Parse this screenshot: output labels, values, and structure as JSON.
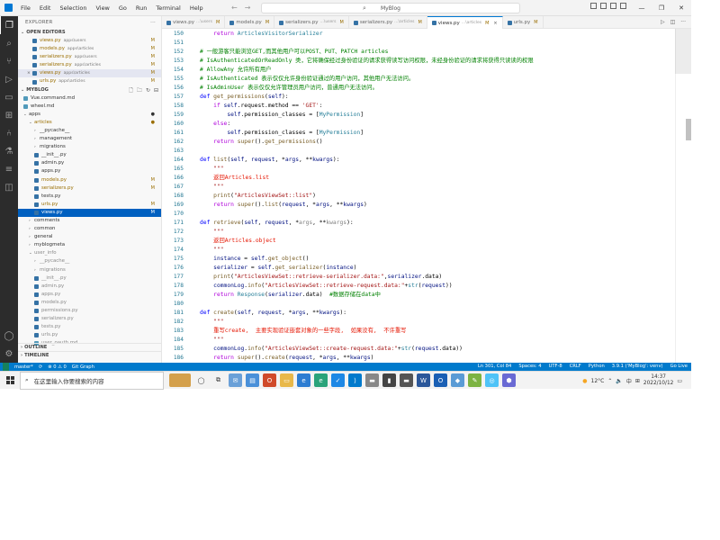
{
  "menu": [
    "File",
    "Edit",
    "Selection",
    "View",
    "Go",
    "Run",
    "Terminal",
    "Help"
  ],
  "search": "MyBlog",
  "sidebar": {
    "title": "EXPLORER",
    "open_editors_title": "OPEN EDITORS",
    "open_editors": [
      {
        "name": "views.py",
        "path": "apps\\users",
        "badge": "M"
      },
      {
        "name": "models.py",
        "path": "apps\\articles",
        "badge": "M"
      },
      {
        "name": "serializers.py",
        "path": "apps\\users",
        "badge": "M"
      },
      {
        "name": "serializers.py",
        "path": "apps\\articles",
        "badge": "M"
      },
      {
        "name": "views.py",
        "path": "apps\\articles",
        "badge": "M"
      },
      {
        "name": "urls.py",
        "path": "apps\\articles",
        "badge": "M"
      }
    ],
    "project_title": "MYBLOG",
    "tree": [
      {
        "label": "Vue.command.md",
        "depth": 1,
        "kind": "md"
      },
      {
        "label": "wheel.md",
        "depth": 1,
        "kind": "md"
      },
      {
        "label": "apps",
        "depth": 1,
        "kind": "folder-open",
        "badge": "●"
      },
      {
        "label": "articles",
        "depth": 2,
        "kind": "folder-open",
        "badge": "●",
        "cls": "mod"
      },
      {
        "label": "__pycache__",
        "depth": 3,
        "kind": "folder"
      },
      {
        "label": "management",
        "depth": 3,
        "kind": "folder"
      },
      {
        "label": "migrations",
        "depth": 3,
        "kind": "folder"
      },
      {
        "label": "__init__.py",
        "depth": 3,
        "kind": "py"
      },
      {
        "label": "admin.py",
        "depth": 3,
        "kind": "py"
      },
      {
        "label": "apps.py",
        "depth": 3,
        "kind": "py"
      },
      {
        "label": "models.py",
        "depth": 3,
        "kind": "py",
        "badge": "M",
        "cls": "mod"
      },
      {
        "label": "serializers.py",
        "depth": 3,
        "kind": "py",
        "badge": "M",
        "cls": "mod"
      },
      {
        "label": "tests.py",
        "depth": 3,
        "kind": "py"
      },
      {
        "label": "urls.py",
        "depth": 3,
        "kind": "py",
        "badge": "M",
        "cls": "mod"
      },
      {
        "label": "views.py",
        "depth": 3,
        "kind": "py",
        "badge": "M",
        "cls": "selected"
      },
      {
        "label": "comments",
        "depth": 2,
        "kind": "folder"
      },
      {
        "label": "common",
        "depth": 2,
        "kind": "folder"
      },
      {
        "label": "general",
        "depth": 2,
        "kind": "folder"
      },
      {
        "label": "myblogmeta",
        "depth": 2,
        "kind": "folder"
      },
      {
        "label": "user_info",
        "depth": 2,
        "kind": "folder-open",
        "cls": "grey"
      },
      {
        "label": "__pycache__",
        "depth": 3,
        "kind": "folder",
        "cls": "grey"
      },
      {
        "label": "migrations",
        "depth": 3,
        "kind": "folder",
        "cls": "grey"
      },
      {
        "label": "__init__.py",
        "depth": 3,
        "kind": "py",
        "cls": "grey"
      },
      {
        "label": "admin.py",
        "depth": 3,
        "kind": "py",
        "cls": "grey"
      },
      {
        "label": "apps.py",
        "depth": 3,
        "kind": "py",
        "cls": "grey"
      },
      {
        "label": "models.py",
        "depth": 3,
        "kind": "py",
        "cls": "grey"
      },
      {
        "label": "permissions.py",
        "depth": 3,
        "kind": "py",
        "cls": "grey"
      },
      {
        "label": "serializers.py",
        "depth": 3,
        "kind": "py",
        "cls": "grey"
      },
      {
        "label": "tests.py",
        "depth": 3,
        "kind": "py",
        "cls": "grey"
      },
      {
        "label": "urls.py",
        "depth": 3,
        "kind": "py",
        "cls": "grey"
      },
      {
        "label": "user_oauth.md",
        "depth": 3,
        "kind": "md",
        "cls": "grey"
      }
    ],
    "outline_title": "OUTLINE",
    "timeline_title": "TIMELINE"
  },
  "tabs": [
    {
      "name": "views.py",
      "path": "...\\users",
      "badge": "M"
    },
    {
      "name": "models.py",
      "path": "",
      "badge": "M"
    },
    {
      "name": "serializers.py",
      "path": "...\\users",
      "badge": "M"
    },
    {
      "name": "serializers.py",
      "path": "...\\articles",
      "badge": "M"
    },
    {
      "name": "views.py",
      "path": "...\\articles",
      "badge": "M",
      "active": true
    },
    {
      "name": "urls.py",
      "path": "",
      "badge": "M"
    }
  ],
  "code": [
    {
      "n": "150",
      "segs": [
        [
          "    ",
          ""
        ],
        [
          "return ",
          "kw2"
        ],
        [
          "ArticlesVisitorSerializer",
          "cls"
        ]
      ]
    },
    {
      "n": "151",
      "segs": []
    },
    {
      "n": "152",
      "segs": [
        [
          "# 一般游客只能浏览GET,而其他用户可以POST、PUT、PATCH articles",
          "cmt"
        ]
      ]
    },
    {
      "n": "153",
      "segs": [
        [
          "# IsAuthenticatedOrReadOnly 类，它将确保经过身份验证的请求获得读写访问权限，未经身份验证的请求将获得只读读的权限",
          "cmt"
        ]
      ]
    },
    {
      "n": "154",
      "segs": [
        [
          "# AllowAny 允许所有用户",
          "cmt"
        ]
      ]
    },
    {
      "n": "155",
      "segs": [
        [
          "# IsAuthenticated 表示仅仅允许身份验证通过的用户访问，其他用户无法访问。",
          "cmt"
        ]
      ]
    },
    {
      "n": "156",
      "segs": [
        [
          "# IsAdminUser 表示仅仅允许管理员用户访问，普通用户无法访问。",
          "cmt"
        ]
      ]
    },
    {
      "n": "157",
      "segs": [
        [
          "def ",
          "kw"
        ],
        [
          "get_permissions",
          "fnc"
        ],
        [
          "(",
          ""
        ],
        [
          "self",
          "var"
        ],
        [
          "):",
          ""
        ]
      ]
    },
    {
      "n": "158",
      "segs": [
        [
          "    ",
          ""
        ],
        [
          "if ",
          "kw2"
        ],
        [
          "self",
          "var"
        ],
        [
          ".request.method == ",
          ""
        ],
        [
          "'GET'",
          "str"
        ],
        [
          ":",
          ""
        ]
      ]
    },
    {
      "n": "159",
      "segs": [
        [
          "        ",
          ""
        ],
        [
          "self",
          "var"
        ],
        [
          ".permission_classes = [",
          ""
        ],
        [
          "MyPermission",
          "cls"
        ],
        [
          "]",
          ""
        ]
      ]
    },
    {
      "n": "160",
      "segs": [
        [
          "    ",
          ""
        ],
        [
          "else",
          "kw2"
        ],
        [
          ":",
          ""
        ]
      ]
    },
    {
      "n": "161",
      "segs": [
        [
          "        ",
          ""
        ],
        [
          "self",
          "var"
        ],
        [
          ".permission_classes = [",
          ""
        ],
        [
          "MyPermission",
          "cls"
        ],
        [
          "]",
          ""
        ]
      ]
    },
    {
      "n": "162",
      "segs": [
        [
          "    ",
          ""
        ],
        [
          "return ",
          "kw2"
        ],
        [
          "super",
          "fnc"
        ],
        [
          "().",
          ""
        ],
        [
          "get_permissions",
          "fnc"
        ],
        [
          "()",
          ""
        ]
      ]
    },
    {
      "n": "163",
      "segs": []
    },
    {
      "n": "164",
      "segs": [
        [
          "def ",
          "kw"
        ],
        [
          "list",
          "fnc"
        ],
        [
          "(",
          ""
        ],
        [
          "self",
          "var"
        ],
        [
          ", ",
          ""
        ],
        [
          "request",
          "var"
        ],
        [
          ", *",
          ""
        ],
        [
          "args",
          "var"
        ],
        [
          ", **",
          ""
        ],
        [
          "kwargs",
          "var"
        ],
        [
          "):",
          ""
        ]
      ]
    },
    {
      "n": "165",
      "segs": [
        [
          "    \"\"\"",
          "str"
        ]
      ]
    },
    {
      "n": "166",
      "segs": [
        [
          "    返回Articles.list",
          "hl"
        ]
      ]
    },
    {
      "n": "167",
      "segs": [
        [
          "    \"\"\"",
          "str"
        ]
      ]
    },
    {
      "n": "168",
      "segs": [
        [
          "    ",
          ""
        ],
        [
          "print",
          "fnc"
        ],
        [
          "(",
          ""
        ],
        [
          "\"ArticlesViewSet::list\"",
          "str"
        ],
        [
          ")",
          ""
        ]
      ]
    },
    {
      "n": "169",
      "segs": [
        [
          "    ",
          ""
        ],
        [
          "return ",
          "kw2"
        ],
        [
          "super",
          "fnc"
        ],
        [
          "().",
          ""
        ],
        [
          "list",
          "fnc"
        ],
        [
          "(",
          ""
        ],
        [
          "request",
          "var"
        ],
        [
          ", *",
          ""
        ],
        [
          "args",
          "var"
        ],
        [
          ", **",
          ""
        ],
        [
          "kwargs",
          "var"
        ],
        [
          ")",
          ""
        ]
      ]
    },
    {
      "n": "170",
      "segs": []
    },
    {
      "n": "171",
      "segs": [
        [
          "def ",
          "kw"
        ],
        [
          "retrieve",
          "fnc"
        ],
        [
          "(",
          ""
        ],
        [
          "self",
          "var"
        ],
        [
          ", ",
          ""
        ],
        [
          "request",
          "var"
        ],
        [
          ", *",
          ""
        ],
        [
          "args",
          "par"
        ],
        [
          ", **",
          ""
        ],
        [
          "kwargs",
          "par"
        ],
        [
          "):",
          ""
        ]
      ]
    },
    {
      "n": "172",
      "segs": [
        [
          "    \"\"\"",
          "str"
        ]
      ]
    },
    {
      "n": "173",
      "segs": [
        [
          "    返回Articles.object",
          "hl"
        ]
      ]
    },
    {
      "n": "174",
      "segs": [
        [
          "    \"\"\"",
          "str"
        ]
      ]
    },
    {
      "n": "175",
      "segs": [
        [
          "    ",
          ""
        ],
        [
          "instance",
          "var"
        ],
        [
          " = ",
          ""
        ],
        [
          "self",
          "var"
        ],
        [
          ".",
          ""
        ],
        [
          "get_object",
          "fnc"
        ],
        [
          "()",
          ""
        ]
      ]
    },
    {
      "n": "176",
      "segs": [
        [
          "    ",
          ""
        ],
        [
          "serializer",
          "var"
        ],
        [
          " = ",
          ""
        ],
        [
          "self",
          "var"
        ],
        [
          ".",
          ""
        ],
        [
          "get_serializer",
          "fnc"
        ],
        [
          "(",
          ""
        ],
        [
          "instance",
          "var"
        ],
        [
          ")",
          ""
        ]
      ]
    },
    {
      "n": "177",
      "segs": [
        [
          "    ",
          ""
        ],
        [
          "print",
          "fnc"
        ],
        [
          "(",
          ""
        ],
        [
          "\"ArticlesViewSet::retrieve-serializer.data:\"",
          "str"
        ],
        [
          ",",
          ""
        ],
        [
          "serializer",
          "var"
        ],
        [
          ".data)",
          ""
        ]
      ]
    },
    {
      "n": "178",
      "segs": [
        [
          "    ",
          ""
        ],
        [
          "commonLog",
          "var"
        ],
        [
          ".",
          ""
        ],
        [
          "info",
          "fnc"
        ],
        [
          "(",
          ""
        ],
        [
          "\"ArticlesViewSet::retrieve-request.data:\"",
          "str"
        ],
        [
          "+",
          ""
        ],
        [
          "str",
          "cls"
        ],
        [
          "(",
          ""
        ],
        [
          "request",
          "var"
        ],
        [
          "))",
          ""
        ]
      ]
    },
    {
      "n": "179",
      "segs": [
        [
          "    ",
          ""
        ],
        [
          "return ",
          "kw2"
        ],
        [
          "Response",
          "cls"
        ],
        [
          "(",
          ""
        ],
        [
          "serializer",
          "var"
        ],
        [
          ".data)  ",
          ""
        ],
        [
          "#数据存储在data中",
          "cmt"
        ]
      ]
    },
    {
      "n": "180",
      "segs": []
    },
    {
      "n": "181",
      "segs": [
        [
          "def ",
          "kw"
        ],
        [
          "create",
          "fnc"
        ],
        [
          "(",
          ""
        ],
        [
          "self",
          "var"
        ],
        [
          ", ",
          ""
        ],
        [
          "request",
          "var"
        ],
        [
          ", *",
          ""
        ],
        [
          "args",
          "var"
        ],
        [
          ", **",
          ""
        ],
        [
          "kwargs",
          "var"
        ],
        [
          "):",
          ""
        ]
      ]
    },
    {
      "n": "182",
      "segs": [
        [
          "    \"\"\"",
          "str"
        ]
      ]
    },
    {
      "n": "183",
      "segs": [
        [
          "    重写create,  主要实现验证嵌套对象的一些字段,  如果没有,  不许重写",
          "hl"
        ]
      ]
    },
    {
      "n": "184",
      "segs": [
        [
          "    \"\"\"",
          "str"
        ]
      ]
    },
    {
      "n": "185",
      "segs": [
        [
          "    ",
          ""
        ],
        [
          "commonLog",
          "var"
        ],
        [
          ".",
          ""
        ],
        [
          "info",
          "fnc"
        ],
        [
          "(",
          ""
        ],
        [
          "\"ArticlesViewSet::create-request.data:\"",
          "str"
        ],
        [
          "+",
          ""
        ],
        [
          "str",
          "cls"
        ],
        [
          "(",
          ""
        ],
        [
          "request",
          "var"
        ],
        [
          ".data))",
          ""
        ]
      ]
    },
    {
      "n": "186",
      "segs": [
        [
          "    ",
          ""
        ],
        [
          "return ",
          "kw2"
        ],
        [
          "super",
          "fnc"
        ],
        [
          "().",
          ""
        ],
        [
          "create",
          "fnc"
        ],
        [
          "(",
          ""
        ],
        [
          "request",
          "var"
        ],
        [
          ", *",
          ""
        ],
        [
          "args",
          "var"
        ],
        [
          ", **",
          ""
        ],
        [
          "kwargs",
          "var"
        ],
        [
          ")",
          ""
        ]
      ]
    }
  ],
  "status": {
    "branch": "master*",
    "sync": "⟳",
    "problems": "⊗ 0 ⚠ 0",
    "git_graph": "Git Graph",
    "position": "Ln 301, Col 84",
    "spaces": "Spaces: 4",
    "encoding": "UTF-8",
    "eol": "CRLF",
    "language": "Python",
    "interpreter": "3.9.1 ('MyBlog': venv)",
    "golive": "Go Live"
  },
  "taskbar": {
    "search_placeholder": "在这里输入你要搜索的内容",
    "weather": "12°C",
    "ime": "中",
    "time": "14:37",
    "date": "2022/10/12"
  },
  "colors": {
    "accent": "#007acc",
    "activity_bar": "#2c2c2c",
    "selection": "#0060c0"
  }
}
